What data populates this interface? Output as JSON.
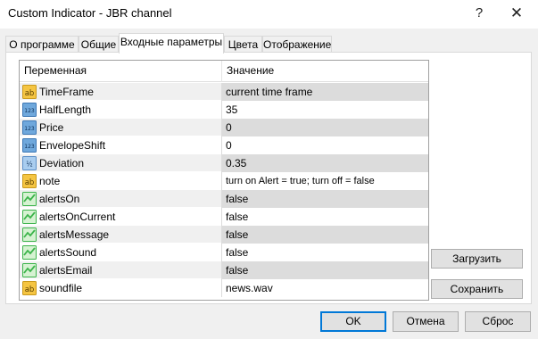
{
  "window": {
    "title": "Custom Indicator - JBR channel",
    "help": "?",
    "close": "✕"
  },
  "tabs": [
    "О программе",
    "Общие",
    "Входные параметры",
    "Цвета",
    "Отображение"
  ],
  "grid": {
    "columns": [
      "Переменная",
      "Значение"
    ],
    "rows": [
      {
        "icon": "ab",
        "name": "TimeFrame",
        "value": "current time frame"
      },
      {
        "icon": "123",
        "name": "HalfLength",
        "value": "35"
      },
      {
        "icon": "123",
        "name": "Price",
        "value": "0"
      },
      {
        "icon": "123",
        "name": "EnvelopeShift",
        "value": "0"
      },
      {
        "icon": "1/2",
        "name": "Deviation",
        "value": "0.35"
      },
      {
        "icon": "ab",
        "name": "note",
        "value": "turn on Alert = true; turn off = false"
      },
      {
        "icon": "bool",
        "name": "alertsOn",
        "value": "false"
      },
      {
        "icon": "bool",
        "name": "alertsOnCurrent",
        "value": "false"
      },
      {
        "icon": "bool",
        "name": "alertsMessage",
        "value": "false"
      },
      {
        "icon": "bool",
        "name": "alertsSound",
        "value": "false"
      },
      {
        "icon": "bool",
        "name": "alertsEmail",
        "value": "false"
      },
      {
        "icon": "ab",
        "name": "soundfile",
        "value": "news.wav"
      }
    ]
  },
  "side_buttons": {
    "load": "Загрузить",
    "save": "Сохранить"
  },
  "footer": {
    "ok": "OK",
    "cancel": "Отмена",
    "reset": "Сброс"
  },
  "colors": {
    "accent": "#0078d7",
    "string_icon": "#f5c542",
    "int_icon": "#6fa8dc",
    "bool_icon": "#3cb44b"
  }
}
